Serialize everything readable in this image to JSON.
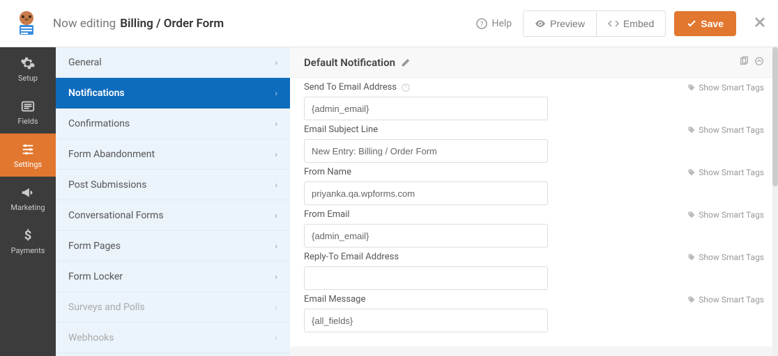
{
  "topbar": {
    "editing_label": "Now editing",
    "form_name": "Billing / Order Form",
    "help_label": "Help",
    "preview_label": "Preview",
    "embed_label": "Embed",
    "save_label": "Save"
  },
  "rail": {
    "items": [
      {
        "label": "Setup"
      },
      {
        "label": "Fields"
      },
      {
        "label": "Settings"
      },
      {
        "label": "Marketing"
      },
      {
        "label": "Payments"
      }
    ]
  },
  "settings_sidebar": {
    "items": [
      {
        "label": "General"
      },
      {
        "label": "Notifications"
      },
      {
        "label": "Confirmations"
      },
      {
        "label": "Form Abandonment"
      },
      {
        "label": "Post Submissions"
      },
      {
        "label": "Conversational Forms"
      },
      {
        "label": "Form Pages"
      },
      {
        "label": "Form Locker"
      },
      {
        "label": "Surveys and Polls"
      },
      {
        "label": "Webhooks"
      }
    ]
  },
  "panel": {
    "title": "Default Notification",
    "smart_tags_label": "Show Smart Tags",
    "fields": {
      "send_to": {
        "label": "Send To Email Address",
        "value": "{admin_email}"
      },
      "subject": {
        "label": "Email Subject Line",
        "value": "New Entry: Billing / Order Form"
      },
      "from_name": {
        "label": "From Name",
        "value": "priyanka.qa.wpforms.com"
      },
      "from_email": {
        "label": "From Email",
        "value": "{admin_email}"
      },
      "reply_to": {
        "label": "Reply-To Email Address",
        "value": ""
      },
      "message": {
        "label": "Email Message",
        "value": "{all_fields}"
      }
    }
  }
}
